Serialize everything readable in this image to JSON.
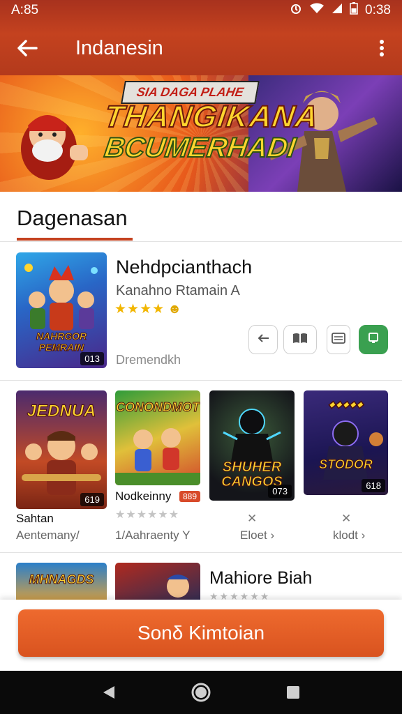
{
  "status_bar": {
    "time_left": "A:85",
    "time_right": "0:38"
  },
  "app_bar": {
    "title": "Indanesin",
    "back_icon": "arrow-left-icon",
    "more_icon": "more-vert-icon"
  },
  "hero": {
    "top_text": "SIA DAGA PLAHE",
    "line1": "THANGIKANA",
    "line2": "BCUMERHADI"
  },
  "section": {
    "label": "Dagenasan"
  },
  "featured": {
    "title": "Nehdpcianthach",
    "subtitle": "Kanahno Rtamain A",
    "stars": "★★★★",
    "developer": "Dremendkh",
    "thumb_title": "NAHRGOR PEMRAIN",
    "thumb_badge": "013",
    "actions": [
      {
        "name": "share",
        "icon": "arrow-icon"
      },
      {
        "name": "read",
        "icon": "book-icon"
      },
      {
        "name": "list",
        "icon": "list-icon"
      },
      {
        "name": "install",
        "icon": "phone-icon"
      }
    ]
  },
  "games": [
    {
      "thumb_title": "JEDNUA",
      "badge": "619",
      "name": "Sahtan",
      "sub": "Aentemany/"
    },
    {
      "thumb_title": "CONONDMOT",
      "badge": "",
      "name": "Nodkeinny",
      "tag": "889",
      "sub": "1/Aahraenty Y",
      "stars": "★★★★★★"
    },
    {
      "thumb_title": "SHUHER CANGOS",
      "badge": "073",
      "name": "✕",
      "sub": "Eloet ›"
    },
    {
      "thumb_title": "STODOR",
      "badge": "618",
      "name": "✕",
      "sub": "klodt ›"
    }
  ],
  "more_row": {
    "title": "Mahiore Biah",
    "stars": "★★★★★★",
    "thumb1_title": "MHNAGDS"
  },
  "cta": {
    "label": "Sonδ Kimtoian"
  },
  "colors": {
    "primary": "#c4421f",
    "accent": "#ee6a2e",
    "install_green": "#3aa050"
  }
}
